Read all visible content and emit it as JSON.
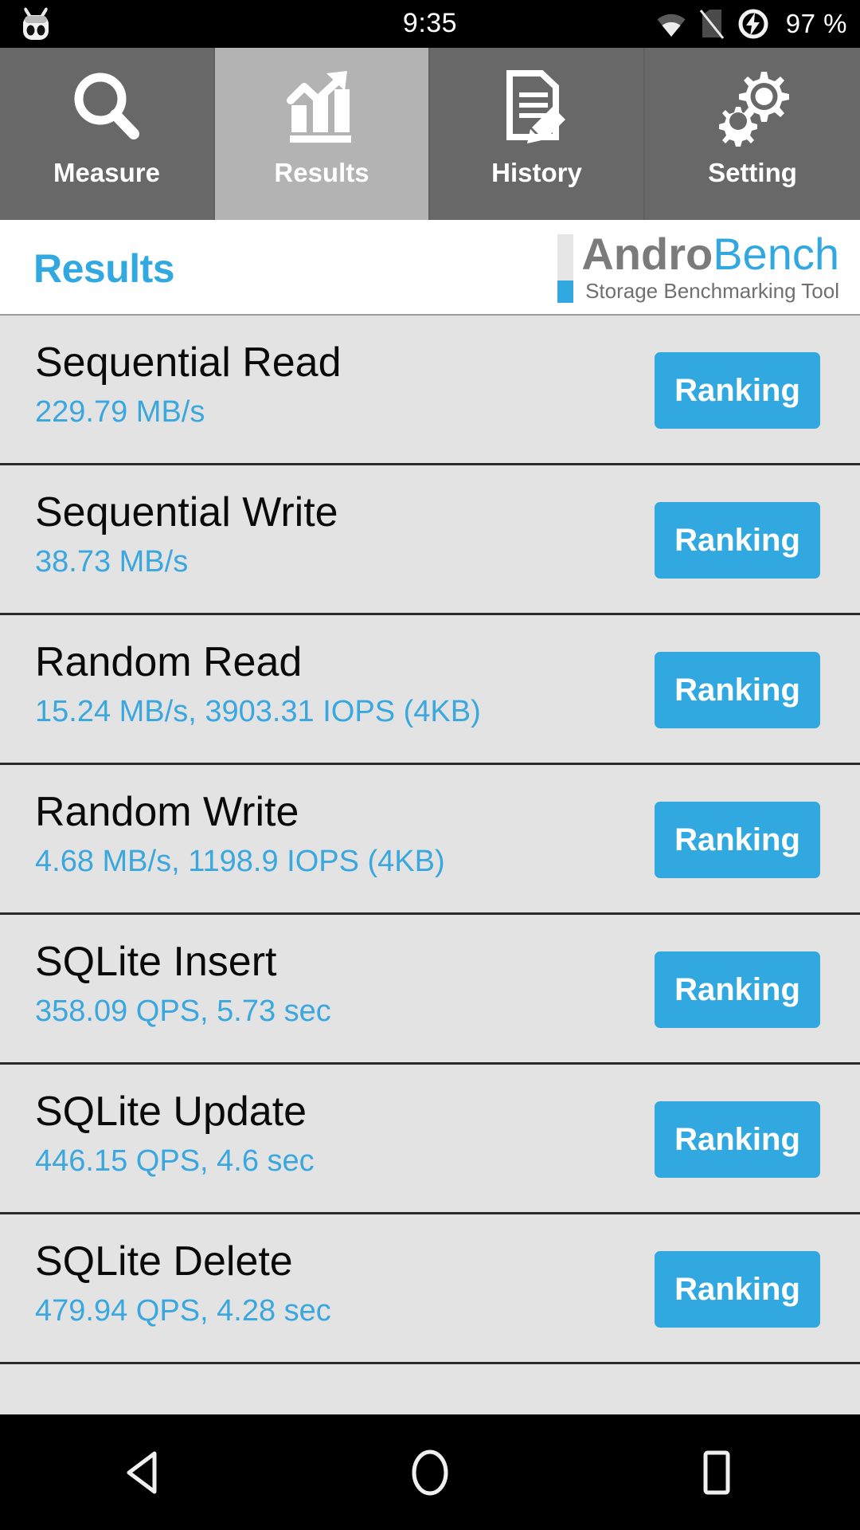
{
  "status_bar": {
    "logo_icon": "cyanogenmod-logo-icon",
    "clock": "9:35",
    "icons": [
      "wifi-icon",
      "no-sim-icon",
      "battery-charging-icon"
    ],
    "battery": "97 %"
  },
  "tabs": [
    {
      "label": "Measure",
      "icon": "magnifier-icon",
      "active": false
    },
    {
      "label": "Results",
      "icon": "bar-chart-icon",
      "active": true
    },
    {
      "label": "History",
      "icon": "document-pencil-icon",
      "active": false
    },
    {
      "label": "Setting",
      "icon": "gears-icon",
      "active": false
    }
  ],
  "header": {
    "title": "Results",
    "brand_primary": "Andro",
    "brand_secondary": "Bench",
    "tagline": "Storage Benchmarking Tool"
  },
  "results": [
    {
      "name": "Sequential Read",
      "value": "229.79 MB/s",
      "action": "Ranking"
    },
    {
      "name": "Sequential Write",
      "value": "38.73 MB/s",
      "action": "Ranking"
    },
    {
      "name": "Random Read",
      "value": "15.24 MB/s, 3903.31 IOPS (4KB)",
      "action": "Ranking"
    },
    {
      "name": "Random Write",
      "value": "4.68 MB/s, 1198.9 IOPS (4KB)",
      "action": "Ranking"
    },
    {
      "name": "SQLite Insert",
      "value": "358.09 QPS, 5.73 sec",
      "action": "Ranking"
    },
    {
      "name": "SQLite Update",
      "value": "446.15 QPS, 4.6 sec",
      "action": "Ranking"
    },
    {
      "name": "SQLite Delete",
      "value": "479.94 QPS, 4.28 sec",
      "action": "Ranking"
    }
  ],
  "nav_bar": {
    "back": "back-triangle-icon",
    "home": "home-circle-icon",
    "recents": "recents-square-icon"
  },
  "colors": {
    "accent_blue": "#32a8e0",
    "value_blue": "#3aa7de",
    "tab_inactive": "#686868",
    "tab_active": "#b3b3b3",
    "list_bg": "#e3e3e3",
    "brand_gray": "#7b7b7b"
  }
}
